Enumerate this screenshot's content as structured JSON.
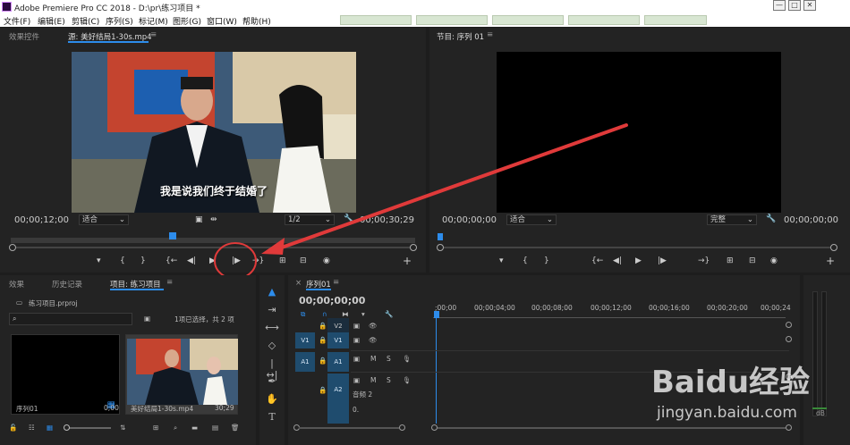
{
  "window": {
    "title": "Adobe Premiere Pro CC 2018 - D:\\pr\\练习项目 *",
    "minimize": "—",
    "maximize": "□",
    "close": "✕"
  },
  "menu": [
    "文件(F)",
    "编辑(E)",
    "剪辑(C)",
    "序列(S)",
    "标记(M)",
    "图形(G)",
    "窗口(W)",
    "帮助(H)"
  ],
  "source_monitor": {
    "tabs": [
      "效果控件",
      "源: 美好结局1-30s.mp4"
    ],
    "menu_icon": "≡",
    "subtitle": "我是说我们终于结婚了",
    "timecode": "00;00;12;00",
    "zoom": "适合",
    "resolution": "1/2",
    "duration": "00;00;30;29",
    "playhead_fraction": 0.4,
    "buttons": [
      "▾",
      "{",
      "}",
      "{←",
      "◀|",
      "▶",
      "|▶",
      "→}",
      "⊞",
      "⊟",
      "◉",
      "+"
    ]
  },
  "program_monitor": {
    "tab": "节目: 序列 01",
    "menu_icon": "≡",
    "timecode": "00;00;00;00",
    "zoom": "适合",
    "quality": "完整",
    "duration": "00;00;00;00",
    "buttons": [
      "▾",
      "{",
      "}",
      "{←",
      "◀|",
      "▶",
      "|▶",
      "→}",
      "⊞",
      "⊟",
      "◉",
      "+"
    ]
  },
  "project_panel": {
    "tabs": [
      "效果",
      "历史记录",
      "项目: 练习项目"
    ],
    "menu_icon": "≡",
    "project_file": "练习项目.prproj",
    "selection_info": "1项已选择，共 2 项",
    "items": [
      {
        "name": "序列01",
        "duration": "0;00"
      },
      {
        "name": "美好结局1-30s.mp4",
        "duration": "30;29"
      }
    ]
  },
  "timeline": {
    "tab": "序列01",
    "menu_icon": "≡",
    "timecode": "00;00;00;00",
    "ruler_labels": [
      ";00;00",
      "00;00;04;00",
      "00;00;08;00",
      "00;00;12;00",
      "00;00;16;00",
      "00;00;20;00",
      "00;00;24"
    ],
    "tracks": [
      {
        "src": "",
        "name": "V2"
      },
      {
        "src": "V1",
        "name": "V1"
      },
      {
        "src": "A1",
        "name": "A1"
      },
      {
        "src": "",
        "name": "A2"
      }
    ],
    "audio_track_label": "音频 2",
    "mute": "M",
    "solo": "S",
    "bottom_value": "0.",
    "db": "dB"
  },
  "annotation": {
    "color": "#e03a3a"
  },
  "watermark": {
    "brand": "Baidu经验",
    "url": "jingyan.baidu.com"
  },
  "colors": {
    "accent": "#2d8ceb",
    "track": "#1f4c6e",
    "panel": "#232323"
  }
}
